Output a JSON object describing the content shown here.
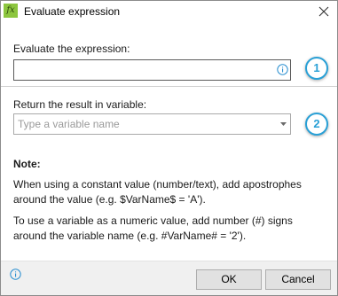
{
  "window": {
    "title": "Evaluate expression",
    "app_icon": "fx-icon",
    "app_icon_text": "fx",
    "close_icon": "close-icon"
  },
  "expression": {
    "label": "Evaluate the expression:",
    "value": "",
    "info_icon": "info-icon",
    "step_badge": "1"
  },
  "result": {
    "label": "Return the result in variable:",
    "placeholder": "Type a variable name",
    "dropdown_icon": "chevron-down-icon",
    "step_badge": "2"
  },
  "note": {
    "title": "Note:",
    "paragraph1": "When using a constant value (number/text), add apostrophes around the value (e.g. $VarName$ = 'A').",
    "paragraph2": "To use a variable as a numeric value, add number (#) signs around the variable name (e.g. #VarName# = '2')."
  },
  "footer": {
    "info_icon": "info-icon",
    "ok_label": "OK",
    "cancel_label": "Cancel"
  },
  "colors": {
    "badge": "#29a0d6",
    "info_icon": "#2a8fd0",
    "app_icon": "#8cc63e",
    "footer_bg": "#f0f0f0"
  }
}
